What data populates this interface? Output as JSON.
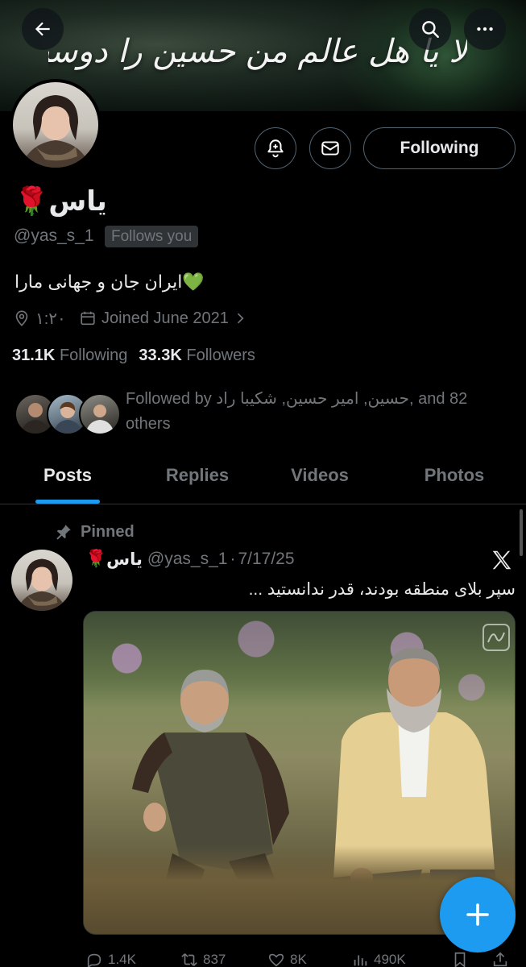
{
  "header": {
    "banner_text": "لا یا هل عالم من حسین را دوست دارم",
    "back_icon": "arrow-left-icon",
    "search_icon": "search-icon",
    "more_icon": "more-horizontal-icon"
  },
  "profile": {
    "name": "یاس",
    "name_emoji": "🌹",
    "handle": "@yas_s_1",
    "follows_you": "Follows you",
    "bio": "ایران جان و جهانی مارا💚",
    "location": "۱:۲۰",
    "joined": "Joined June 2021",
    "following_count": "31.1K",
    "following_label": "Following",
    "followers_count": "33.3K",
    "followers_label": "Followers",
    "followed_by": "Followed by حسین, امیر حسین, شکیبا راد, and 82 others",
    "follow_button": "Following"
  },
  "tabs": [
    {
      "label": "Posts",
      "active": true
    },
    {
      "label": "Replies",
      "active": false
    },
    {
      "label": "Videos",
      "active": false
    },
    {
      "label": "Photos",
      "active": false
    }
  ],
  "post": {
    "pinned_label": "Pinned",
    "author_name": "یاس",
    "author_emoji": "🌹",
    "author_handle": "@yas_s_1",
    "separator": "·",
    "date": "7/17/25",
    "text": "سپر بلای منطقه بودند، قدر ندانستید ...",
    "stats": {
      "replies": "1.4K",
      "reposts": "837",
      "likes": "8K",
      "views": "490K"
    }
  },
  "colors": {
    "accent": "#1d9bf0",
    "background": "#000000",
    "text_primary": "#e7e9ea",
    "text_secondary": "#71767b",
    "border": "#2f3336"
  }
}
